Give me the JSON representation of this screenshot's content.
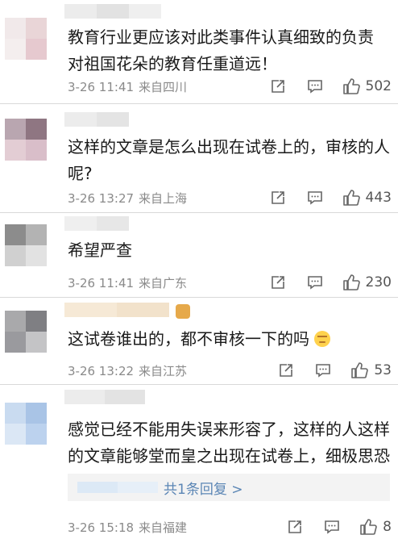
{
  "colors": {
    "link": "#5b86b5",
    "meta": "#8a8a8a",
    "text": "#1a1a1a",
    "divider": "#d9d9d9",
    "reply_bg": "#f3f3f3"
  },
  "comments": [
    {
      "text_lines": [
        "教育行业更应该对此类事件认真细致的负责",
        "对祖国花朵的教育任重道远！"
      ],
      "time": "3-26 11:41",
      "location": "来自四川",
      "likes": "502"
    },
    {
      "text_lines": [
        "这样的文章是怎么出现在试卷上的，审核的人",
        "呢?"
      ],
      "time": "3-26 13:27",
      "location": "来自上海",
      "likes": "443"
    },
    {
      "text_lines": [
        "希望严查"
      ],
      "time": "3-26 11:41",
      "location": "来自广东",
      "likes": "230"
    },
    {
      "text_lines": [
        "这试卷谁出的，都不审核一下的吗"
      ],
      "time": "3-26 13:22",
      "location": "来自江苏",
      "likes": "53"
    },
    {
      "text_lines": [
        "感觉已经不能用失误来形容了，这样的人这样",
        "的文章能够堂而皇之出现在试卷上，细极思恐"
      ],
      "reply_link": "共1条回复 >",
      "time": "3-26 15:18",
      "location": "来自福建",
      "likes": "8"
    }
  ],
  "icons": {
    "share": "share-icon",
    "comment": "comment-icon",
    "like": "thumbs-up-icon",
    "emoji": "emoji-icon"
  }
}
